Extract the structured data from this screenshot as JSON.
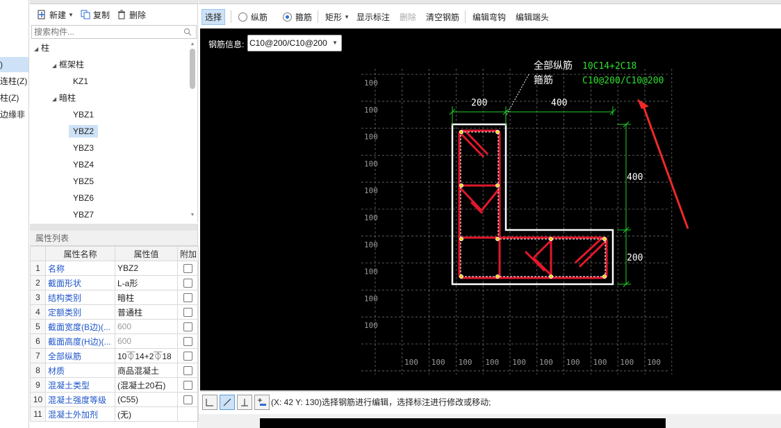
{
  "left_strip": {
    "items": [
      ")",
      "连柱(Z)",
      "柱(Z)",
      "边缘非"
    ]
  },
  "component_panel": {
    "toolbar": {
      "new_label": "新建",
      "copy_label": "复制",
      "delete_label": "删除"
    },
    "search": {
      "placeholder": "搜索构件..."
    },
    "tree": {
      "root": "柱",
      "group1": "框架柱",
      "kz1": "KZ1",
      "group2": "暗柱",
      "items": [
        "YBZ1",
        "YBZ2",
        "YBZ3",
        "YBZ4",
        "YBZ5",
        "YBZ6",
        "YBZ7"
      ]
    }
  },
  "property_panel": {
    "title": "属性列表",
    "headers": {
      "name": "属性名称",
      "value": "属性值",
      "extra": "附加"
    },
    "rows": [
      {
        "num": "1",
        "name": "名称",
        "value": "YBZ2"
      },
      {
        "num": "2",
        "name": "截面形状",
        "value": "L-a形"
      },
      {
        "num": "3",
        "name": "结构类别",
        "value": "暗柱"
      },
      {
        "num": "4",
        "name": "定额类别",
        "value": "普通柱"
      },
      {
        "num": "5",
        "name": "截面宽度(B边)(...",
        "value": "600"
      },
      {
        "num": "6",
        "name": "截面高度(H边)(...",
        "value": "600"
      },
      {
        "num": "7",
        "name": "全部纵筋",
        "value": "10⏁14+2⏁18"
      },
      {
        "num": "8",
        "name": "材质",
        "value": "商品混凝土"
      },
      {
        "num": "9",
        "name": "混凝土类型",
        "value": "(混凝土20石)"
      },
      {
        "num": "10",
        "name": "混凝土强度等级",
        "value": "(C55)"
      },
      {
        "num": "11",
        "name": "混凝土外加剂",
        "value": "(无)"
      }
    ]
  },
  "main_toolbar": {
    "select_label": "选择",
    "longitudinal_label": "纵筋",
    "stirrup_label": "箍筋",
    "rect_label": "矩形",
    "show_dims_label": "显示标注",
    "delete_label": "删除",
    "clear_label": "清空钢筋",
    "edit_bend_label": "编辑弯钩",
    "edit_end_label": "编辑端头"
  },
  "canvas": {
    "info_label": "钢筋信息:",
    "info_value": "C10@200/C10@200",
    "anno_all_label": "全部纵筋",
    "anno_all_value": "10C14+2C18",
    "anno_stirrup_label": "箍筋",
    "anno_stirrup_value": "C10@200/C10@200",
    "dim_top_left": "200",
    "dim_top_right": "400",
    "dim_right_top": "400",
    "dim_right_bottom": "200",
    "grid_label": "100",
    "colors": {
      "concrete": "#ffffff",
      "rebar": "#e0182c",
      "dim": "#1fd12a",
      "anno_green": "#2ee02e",
      "arrow": "#ee2a2a",
      "grid": "#7a7a7a"
    }
  },
  "statusbar": {
    "text": "(X: 42 Y: 130)选择钢筋进行编辑，选择标注进行修改或移动;"
  }
}
